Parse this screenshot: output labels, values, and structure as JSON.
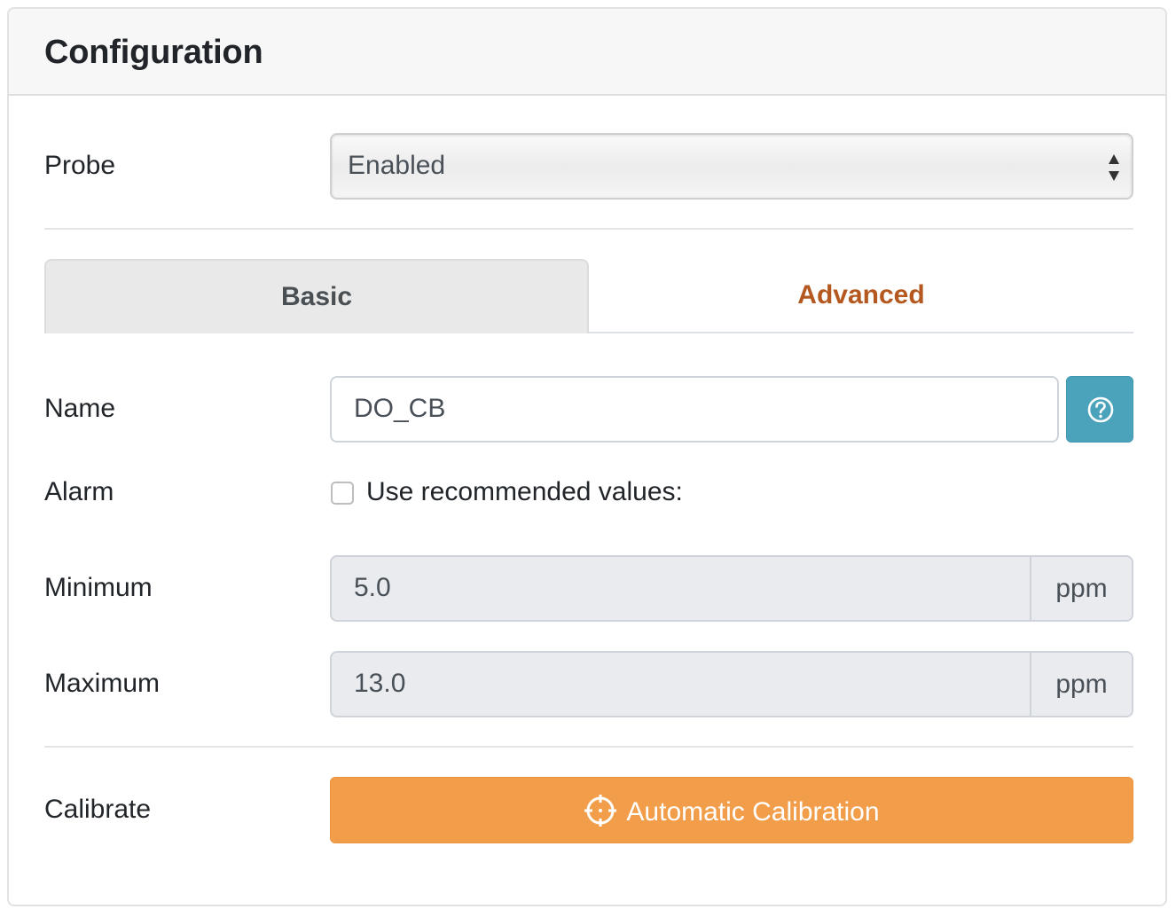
{
  "card": {
    "title": "Configuration"
  },
  "probe": {
    "label": "Probe",
    "selected": "Enabled"
  },
  "tabs": [
    {
      "label": "Basic",
      "active": false
    },
    {
      "label": "Advanced",
      "active": true
    }
  ],
  "name": {
    "label": "Name",
    "value": "DO_CB",
    "help_icon": "question-circle-icon"
  },
  "alarm": {
    "label": "Alarm",
    "checkbox_label": "Use recommended values:",
    "checked": false
  },
  "minimum": {
    "label": "Minimum",
    "value": "5.0",
    "unit": "ppm"
  },
  "maximum": {
    "label": "Maximum",
    "value": "13.0",
    "unit": "ppm"
  },
  "calibrate": {
    "label": "Calibrate",
    "button_label": "Automatic Calibration",
    "button_icon": "crosshairs-icon"
  },
  "colors": {
    "accent_orange": "#f29d4a",
    "tab_active_text": "#b4581f",
    "help_button": "#4aa3ba"
  }
}
